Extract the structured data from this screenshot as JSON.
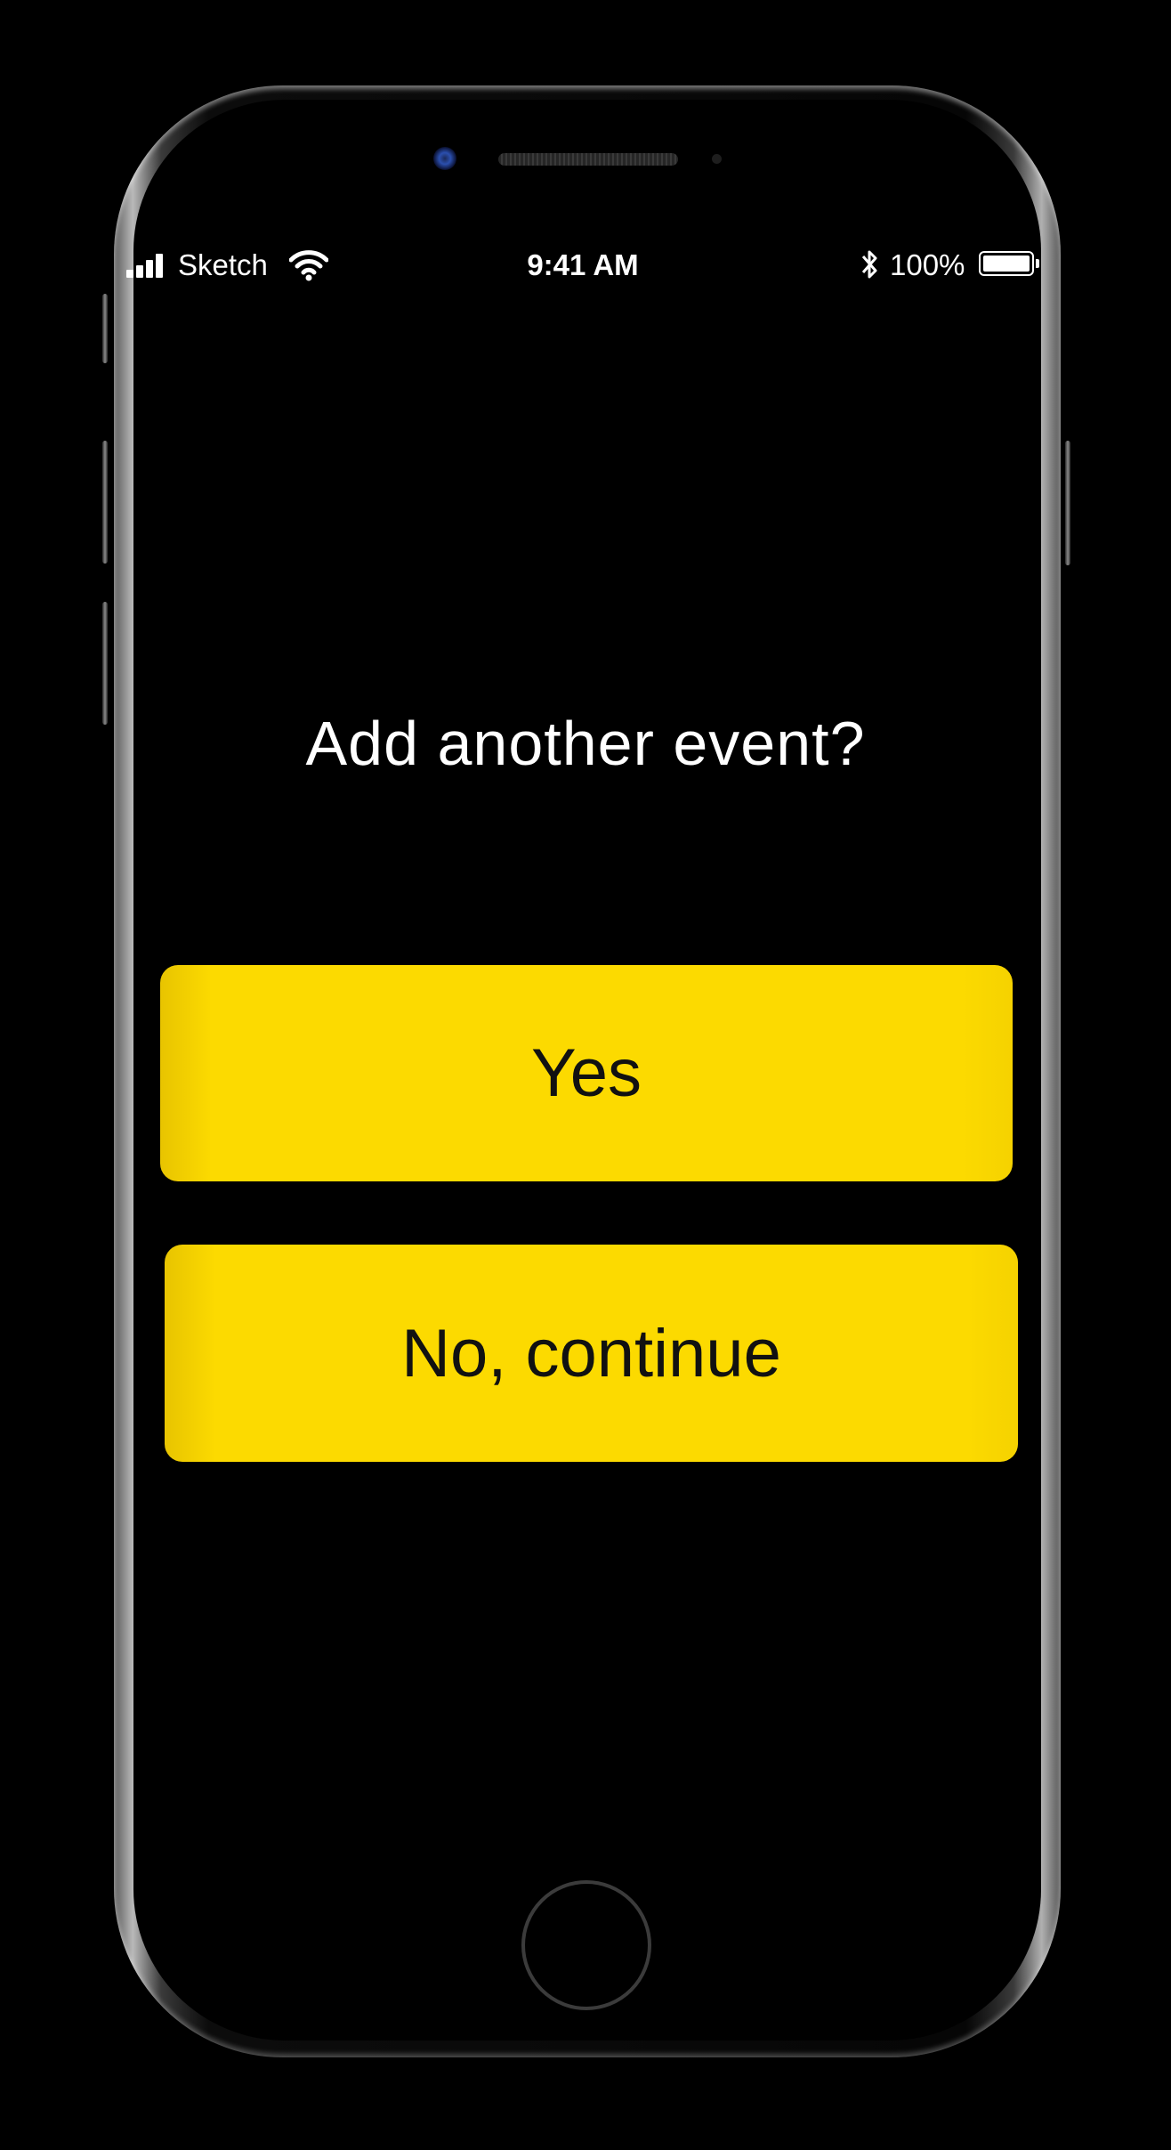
{
  "status_bar": {
    "carrier": "Sketch",
    "time": "9:41 AM",
    "battery_percent": "100%",
    "signal_icon": "cellular-signal-icon",
    "wifi_icon": "wifi-icon",
    "bluetooth_icon": "bluetooth-icon",
    "battery_icon": "battery-icon",
    "battery_level": 1.0
  },
  "prompt": {
    "question": "Add another event?"
  },
  "actions": {
    "yes_label": "Yes",
    "no_label": "No, continue"
  },
  "device": {
    "home_button_icon": "home-button"
  },
  "colors": {
    "background": "#000000",
    "button": "#FCDA00",
    "button_text": "#111111",
    "text": "#FFFFFF"
  }
}
